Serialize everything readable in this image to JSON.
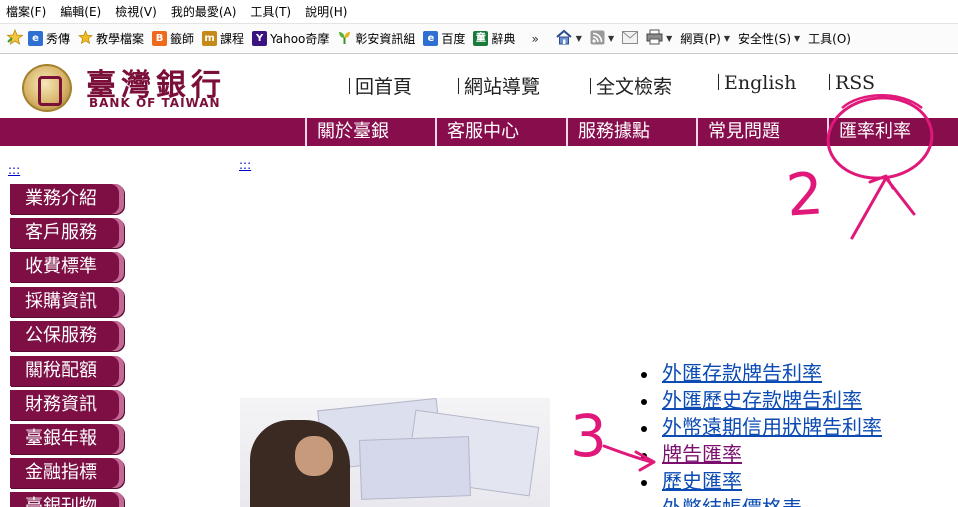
{
  "browser": {
    "menu": [
      "檔案(F)",
      "編輯(E)",
      "檢視(V)",
      "我的最愛(A)",
      "工具(T)",
      "說明(H)"
    ],
    "favorites": [
      {
        "label": "秀傳",
        "icon": "ie-page-icon",
        "color": "#2e6fd1"
      },
      {
        "label": "教學檔案",
        "icon": "star-icon",
        "color": "#e8b21c"
      },
      {
        "label": "籤師",
        "icon": "blogger-icon",
        "color": "#f06a1d"
      },
      {
        "label": "課程",
        "icon": "moodle-icon",
        "color": "#c58a17"
      },
      {
        "label": "Yahoo奇摩",
        "icon": "yahoo-icon",
        "color": "#3b1380"
      },
      {
        "label": "彰安資訊組",
        "icon": "plant-icon",
        "color": "#3c8f2a"
      },
      {
        "label": "百度",
        "icon": "ie-page-icon",
        "color": "#2e6fd1"
      },
      {
        "label": "辭典",
        "icon": "dictionary-icon",
        "color": "#1a7a3a"
      }
    ],
    "chevron": "»",
    "commands": [
      {
        "icon": "home-icon"
      },
      {
        "icon": "rss-feed-icon"
      },
      {
        "icon": "mail-icon"
      },
      {
        "icon": "print-icon"
      },
      {
        "label": "網頁(P)"
      },
      {
        "label": "安全性(S)"
      },
      {
        "label": "工具(O)"
      }
    ]
  },
  "site": {
    "logo_zh": "臺灣銀行",
    "logo_en": "BANK OF TAIWAN",
    "top_links": [
      "回首頁",
      "網站導覽",
      "全文檢索",
      "English",
      "RSS"
    ],
    "nav_tabs": [
      "關於臺銀",
      "客服中心",
      "服務據點",
      "常見問題",
      "匯率利率"
    ],
    "skip_marker": ":::",
    "sidebar": [
      "業務介紹",
      "客戶服務",
      "收費標準",
      "採購資訊",
      "公保服務",
      "關稅配額",
      "財務資訊",
      "臺銀年報",
      "金融指標",
      "臺銀刊物"
    ],
    "rate_links": [
      {
        "label": "外匯存款牌告利率",
        "visited": false
      },
      {
        "label": "外匯歷史存款牌告利率",
        "visited": false
      },
      {
        "label": "外幣遠期信用狀牌告利率",
        "visited": false
      },
      {
        "label": "牌告匯率",
        "visited": true
      },
      {
        "label": "歷史匯率",
        "visited": false
      },
      {
        "label": "外幣結帳價格表",
        "visited": false
      }
    ]
  },
  "annotations": {
    "step2": "2",
    "step3": "3",
    "color": "#e0187a"
  }
}
